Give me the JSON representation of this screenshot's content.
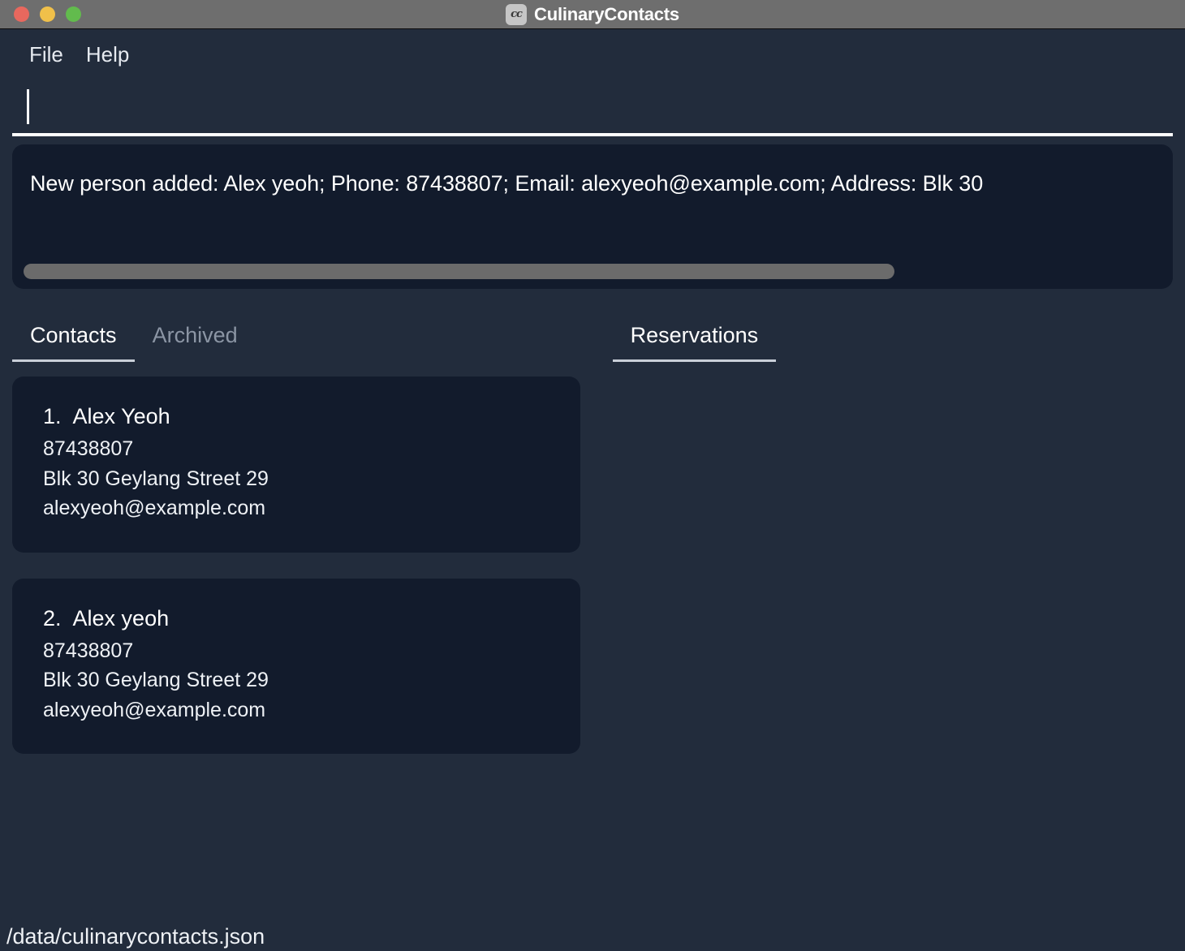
{
  "window": {
    "title": "CulinaryContacts",
    "app_icon_glyph": "cc",
    "controls": {
      "close_label": "close-button",
      "minimize_label": "minimize-button",
      "maximize_label": "maximize-button"
    },
    "colors": {
      "titlebar": "#6e6e6e",
      "close": "#e8685e",
      "minimize": "#f0c04a",
      "maximize": "#62bb4d",
      "background": "#222c3c",
      "card": "#121b2c",
      "accent_text": "#ffffff",
      "muted_text": "#8b95a4",
      "scrollbar": "#6b6b6b"
    }
  },
  "menubar": {
    "items": [
      {
        "label": "File"
      },
      {
        "label": "Help"
      }
    ]
  },
  "command": {
    "value": "",
    "placeholder": ""
  },
  "result": {
    "text": "New person added: Alex yeoh; Phone: 87438807; Email: alexyeoh@example.com; Address: Blk 30",
    "scrollbar_fraction": 76.5
  },
  "left_tabs": [
    {
      "label": "Contacts",
      "active": true
    },
    {
      "label": "Archived",
      "active": false
    }
  ],
  "right_tabs": [
    {
      "label": "Reservations",
      "active": true
    }
  ],
  "contacts": [
    {
      "index": "1.",
      "name": "Alex Yeoh",
      "phone": "87438807",
      "address": "Blk 30 Geylang Street 29",
      "email": "alexyeoh@example.com"
    },
    {
      "index": "2.",
      "name": "Alex yeoh",
      "phone": "87438807",
      "address": "Blk 30 Geylang Street 29",
      "email": "alexyeoh@example.com"
    }
  ],
  "reservations": [],
  "statusbar": {
    "path": "/data/culinarycontacts.json"
  }
}
